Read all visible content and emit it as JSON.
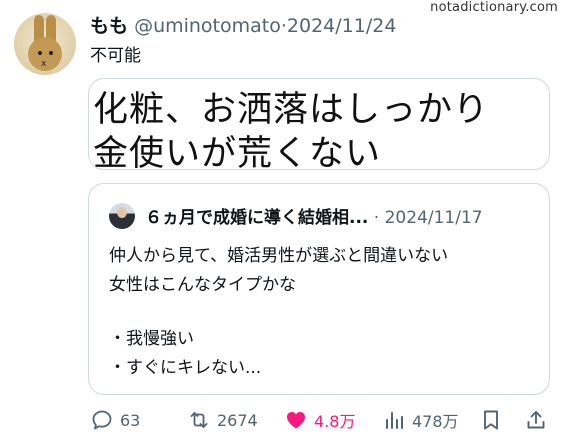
{
  "watermark": "notadictionary.com",
  "post": {
    "display_name": "もも",
    "handle": "@uminotomato",
    "separator": "·",
    "date": "2024/11/24",
    "text": "不可能",
    "image_lines": [
      "化粧、お洒落はしっかり",
      "金使いが荒くない"
    ]
  },
  "quote": {
    "display_name": "６ヵ月で成婚に導く結婚相...",
    "separator": "·",
    "date": "2024/11/17",
    "lines": [
      "仲人から見て、婚活男性が選ぶと間違いない",
      "女性はこんなタイプかな",
      "",
      "・我慢強い",
      "・すぐにキレない..."
    ]
  },
  "actions": {
    "replies": "63",
    "reposts": "2674",
    "likes": "4.8万",
    "views": "478万"
  },
  "colors": {
    "text": "#0f1419",
    "secondary": "#536471",
    "like": "#f91880",
    "border": "#cfd9de"
  },
  "icons": [
    "reply-icon",
    "repost-icon",
    "like-icon",
    "views-icon",
    "bookmark-icon",
    "share-icon"
  ]
}
